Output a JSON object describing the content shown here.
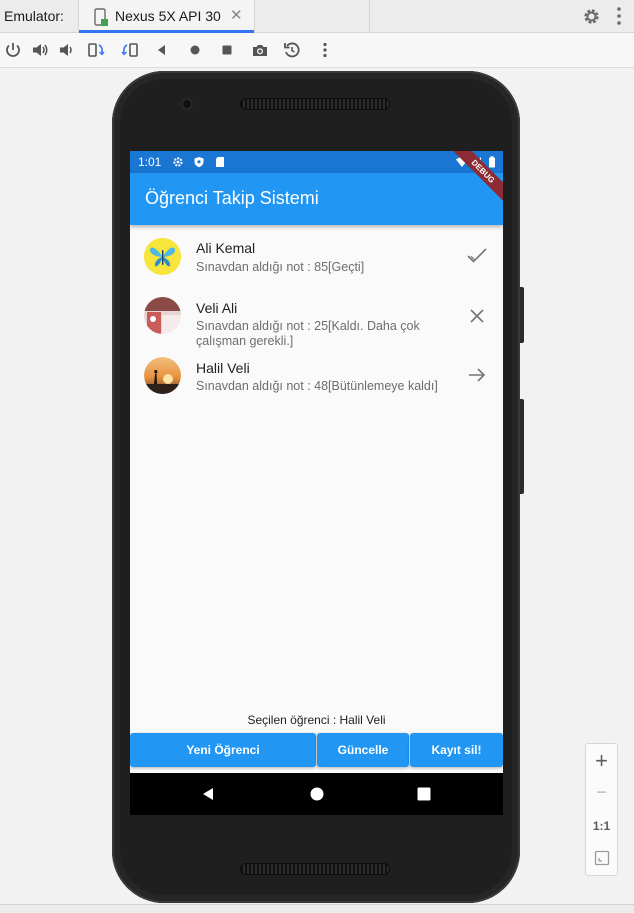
{
  "emulator_label": "Emulator:",
  "tab": {
    "title": "Nexus 5X API 30",
    "close_glyph": "✕"
  },
  "toolbar_icons": [
    "power-icon",
    "volume-up-icon",
    "volume-down-icon",
    "rotate-left-icon",
    "rotate-right-icon",
    "back-icon",
    "home-icon",
    "overview-icon",
    "screenshot-icon",
    "snapshot-icon",
    "more-icon"
  ],
  "status_bar": {
    "time": "1:01"
  },
  "app": {
    "title": "Öğrenci Takip Sistemi",
    "debug_banner": "DEBUG",
    "students": [
      {
        "name": "Ali Kemal",
        "subtitle": "Sınavdan aldığı not : 85[Geçti]",
        "trailing_icon": "check-icon"
      },
      {
        "name": "Veli Ali",
        "subtitle": "Sınavdan aldığı not : 25[Kaldı. Daha çok çalışman gerekli.]",
        "trailing_icon": "close-icon"
      },
      {
        "name": "Halil Veli",
        "subtitle": "Sınavdan aldığı not : 48[Bütünlemeye kaldı]",
        "trailing_icon": "arrow-right-icon"
      }
    ],
    "selected_text": "Seçilen öğrenci : Halil Veli",
    "buttons": {
      "new": "Yeni Öğrenci",
      "update": "Güncelle",
      "delete": "Kayıt sil!"
    }
  },
  "zoom": {
    "plus": "+",
    "minus": "−",
    "one_to_one": "1:1"
  },
  "colors": {
    "primary": "#2196f3",
    "status_bar": "#1976d2",
    "tab_accent": "#3574f0"
  }
}
